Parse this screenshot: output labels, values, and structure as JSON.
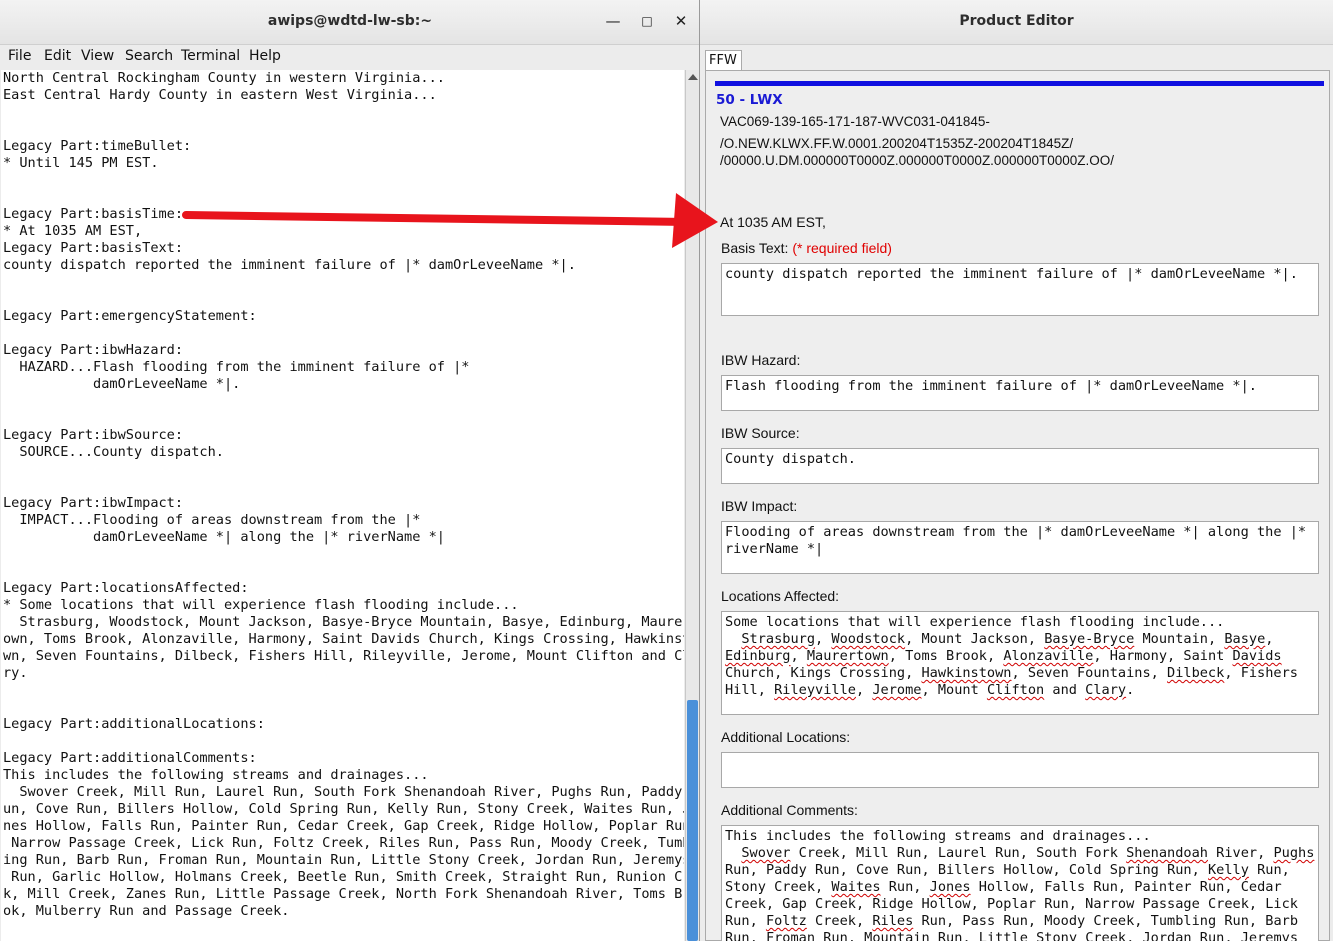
{
  "terminal": {
    "title": "awips@wdtd-lw-sb:~",
    "menu": [
      "File",
      "Edit",
      "View",
      "Search",
      "Terminal",
      "Help"
    ],
    "lines": [
      "North Central Rockingham County in western Virginia...",
      "East Central Hardy County in eastern West Virginia...",
      "",
      "",
      "Legacy Part:timeBullet:",
      "* Until 145 PM EST.",
      "",
      "",
      "Legacy Part:basisTime:",
      "* At 1035 AM EST,",
      "Legacy Part:basisText:",
      "county dispatch reported the imminent failure of |* damOrLeveeName *|.",
      "",
      "",
      "Legacy Part:emergencyStatement:",
      "",
      "Legacy Part:ibwHazard:",
      "  HAZARD...Flash flooding from the imminent failure of |*",
      "           damOrLeveeName *|.",
      "",
      "",
      "Legacy Part:ibwSource:",
      "  SOURCE...County dispatch.",
      "",
      "",
      "Legacy Part:ibwImpact:",
      "  IMPACT...Flooding of areas downstream from the |*",
      "           damOrLeveeName *| along the |* riverName *|",
      "",
      "",
      "Legacy Part:locationsAffected:",
      "* Some locations that will experience flash flooding include...",
      "  Strasburg, Woodstock, Mount Jackson, Basye-Bryce Mountain, Basye, Edinburg, Maurert",
      "own, Toms Brook, Alonzaville, Harmony, Saint Davids Church, Kings Crossing, Hawkinsto",
      "wn, Seven Fountains, Dilbeck, Fishers Hill, Rileyville, Jerome, Mount Clifton and Cla",
      "ry.",
      "",
      "",
      "Legacy Part:additionalLocations:",
      "",
      "Legacy Part:additionalComments:",
      "This includes the following streams and drainages...",
      "  Swover Creek, Mill Run, Laurel Run, South Fork Shenandoah River, Pughs Run, Paddy R",
      "un, Cove Run, Billers Hollow, Cold Spring Run, Kelly Run, Stony Creek, Waites Run, Jo",
      "nes Hollow, Falls Run, Painter Run, Cedar Creek, Gap Creek, Ridge Hollow, Poplar Run,",
      " Narrow Passage Creek, Lick Run, Foltz Creek, Riles Run, Pass Run, Moody Creek, Tumbl",
      "ing Run, Barb Run, Froman Run, Mountain Run, Little Stony Creek, Jordan Run, Jeremys",
      " Run, Garlic Hollow, Holmans Creek, Beetle Run, Smith Creek, Straight Run, Runion Cree",
      "k, Mill Creek, Zanes Run, Little Passage Creek, North Fork Shenandoah River, Toms Bro",
      "ok, Mulberry Run and Passage Creek."
    ]
  },
  "editor": {
    "title": "Product Editor",
    "tab": "FFW",
    "segment_title": "50 - LWX",
    "vtec": [
      "VAC069-139-165-171-187-WVC031-041845-",
      "/O.NEW.KLWX.FF.W.0001.200204T1535Z-200204T1845Z/",
      "/00000.U.DM.000000T0000Z.000000T0000Z.000000T0000Z.OO/"
    ],
    "basis_time": "At 1035 AM EST,",
    "basis_text_label": "Basis Text:",
    "required_note": "(* required field)",
    "basis_text": "county dispatch reported the imminent failure of |* damOrLeveeName *|.",
    "ibw_hazard_label": "IBW Hazard:",
    "ibw_hazard": "Flash flooding from the imminent failure of |* damOrLeveeName *|.",
    "ibw_source_label": "IBW Source:",
    "ibw_source": "County dispatch.",
    "ibw_impact_label": "IBW Impact:",
    "ibw_impact": "Flooding of areas downstream from the |* damOrLeveeName *| along the |*\nriverName *|",
    "locations_label": "Locations Affected:",
    "locations": "Some locations that will experience flash flooding include...\n  Strasburg, Woodstock, Mount Jackson, Basye-Bryce Mountain, Basye,\nEdinburg, Maurertown, Toms Brook, Alonzaville, Harmony, Saint Davids\nChurch, Kings Crossing, Hawkinstown, Seven Fountains, Dilbeck, Fishers\nHill, Rileyville, Jerome, Mount Clifton and Clary.",
    "additional_locations_label": "Additional Locations:",
    "additional_locations": "",
    "additional_comments_label": "Additional Comments:",
    "additional_comments": "This includes the following streams and drainages...\n  Swover Creek, Mill Run, Laurel Run, South Fork Shenandoah River, Pughs\nRun, Paddy Run, Cove Run, Billers Hollow, Cold Spring Run, Kelly Run,\nStony Creek, Waites Run, Jones Hollow, Falls Run, Painter Run, Cedar\nCreek, Gap Creek, Ridge Hollow, Poplar Run, Narrow Passage Creek, Lick\nRun, Foltz Creek, Riles Run, Pass Run, Moody Creek, Tumbling Run, Barb\nRun, Froman Run, Mountain Run, Little Stony Creek, Jordan Run, Jeremys",
    "spellcheck_flagged": [
      "Strasburg",
      "Woodstock",
      "Basye-Bryce",
      "Basye",
      "Edinburg",
      "Maurertown",
      "Alonzaville",
      "Davids",
      "Hawkinstown",
      "Dilbeck",
      "Rileyville",
      "Jerome",
      "Clifton",
      "Clary",
      "Swover",
      "Shenandoah",
      "Pughs",
      "Kelly",
      "Waites",
      "Jones",
      "Foltz",
      "Riles"
    ]
  },
  "colors": {
    "segment_title": "#1a1ad4",
    "blue_bar": "#1010e0",
    "required": "#e00000",
    "annotation_arrow": "#e8141c",
    "scrollbar_thumb": "#4a90d9"
  }
}
